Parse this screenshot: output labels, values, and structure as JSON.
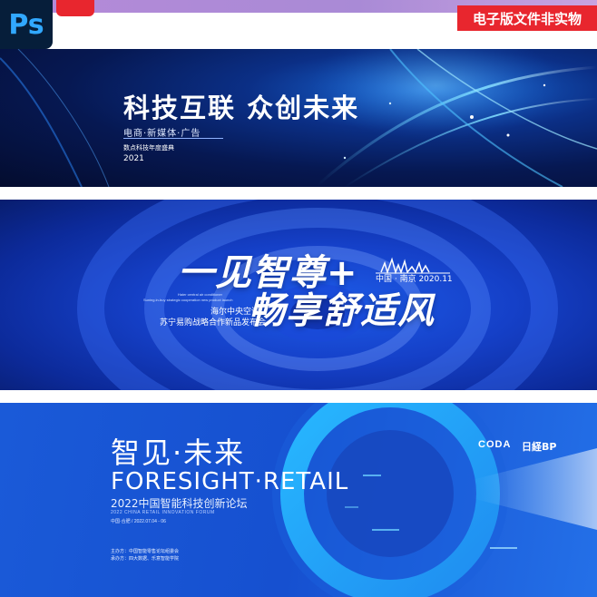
{
  "header": {
    "app_logo": "Ps",
    "notice_badge": "电子版文件非实物"
  },
  "banner1": {
    "title": "科技互联 众创未来",
    "subtitle": "电商·新媒体·广告",
    "subtitle2": "数点科技年度盛典",
    "year": "2021"
  },
  "banner2": {
    "title_line1": "一见智尊+",
    "title_line2": "畅享舒适风",
    "location_date": "中国 · 南京 2020.11",
    "en_line1": "Haier central air conditioner",
    "en_line2": "Suning.in-buy strategic cooperation new product launch",
    "brand": "海尔中央空调",
    "launch": "苏宁易购战略合作新品发布会"
  },
  "banner3": {
    "title": "智见·未来",
    "english_title": "FORESIGHT·RETAIL",
    "forum": "2022中国智能科技创新论坛",
    "forum_en": "2022 CHINA RETAIL INNOVATION FORUM",
    "place_date": "中国·合肥 / 2022.07.04 - 06",
    "host1": "主办方：中国智能零售论坛组委会",
    "host2": "承办方：四大数据、乐意智能学院",
    "logo1": "CODA",
    "logo2": "日経BP"
  },
  "colors": {
    "accent_red": "#e8262e",
    "ps_blue": "#31a8ff",
    "cyan": "#2cc6ff"
  }
}
